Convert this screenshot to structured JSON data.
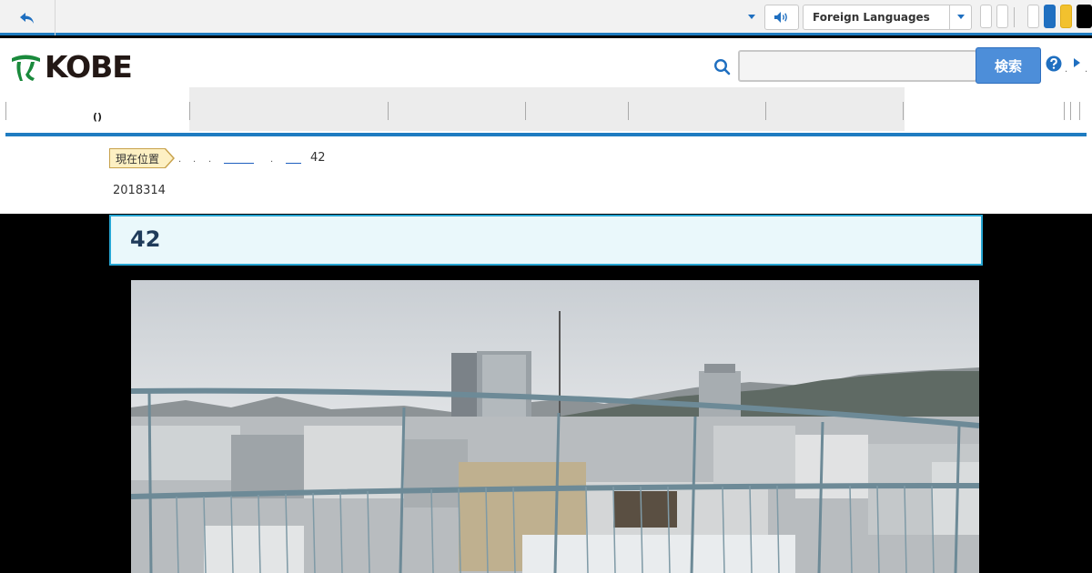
{
  "topbar": {
    "language_select": "Foreign Languages"
  },
  "header": {
    "logo_text": "KOBE",
    "search_button": "検索",
    "search_placeholder": ""
  },
  "nav": {
    "active_item": "()"
  },
  "breadcrumb": {
    "label": "現在位置",
    "current": "42"
  },
  "page": {
    "date": "2018314",
    "title": "42"
  },
  "colors": {
    "accent": "#1f7cc1",
    "title_border": "#27a6d3",
    "search_button": "#4d8ed9",
    "logo_green": "#1a8a3c"
  }
}
